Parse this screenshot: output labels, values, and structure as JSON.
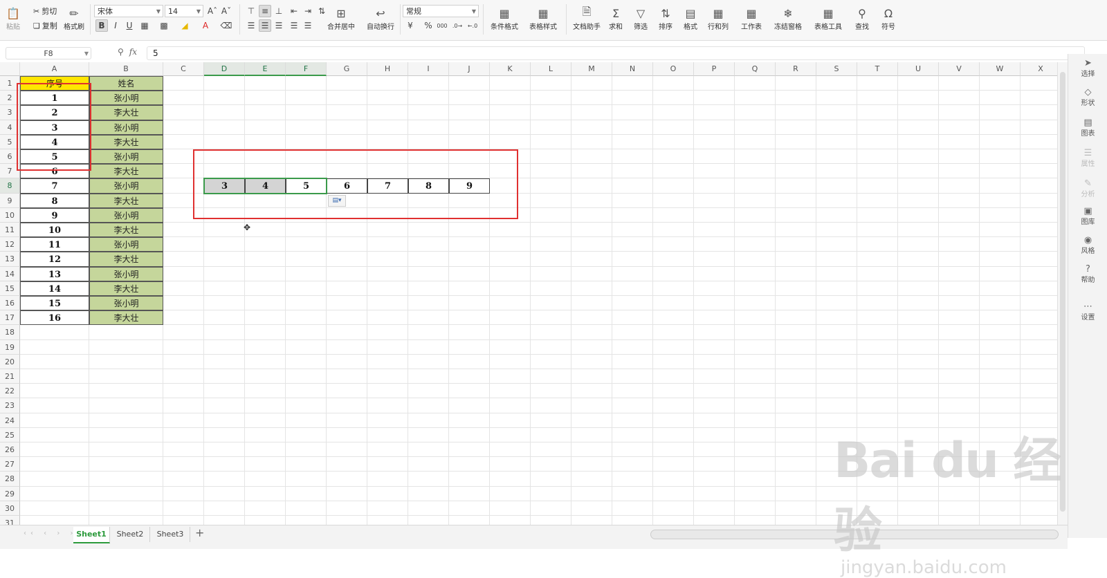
{
  "ribbon": {
    "paste": "粘贴",
    "cut": "剪切",
    "copy": "复制",
    "format_painter": "格式刷",
    "font_name": "宋体",
    "font_size": "14",
    "number_format": "常规",
    "merge_center": "合并居中",
    "wrap_text": "自动换行",
    "cond_format": "条件格式",
    "table_style": "表格样式",
    "doc_assist": "文档助手",
    "sum": "求和",
    "filter": "筛选",
    "sort": "排序",
    "format": "格式",
    "row_col": "行和列",
    "worksheet": "工作表",
    "freeze": "冻结窗格",
    "table_tools": "表格工具",
    "find": "查找",
    "symbol": "符号",
    "bold": "B",
    "italic": "I",
    "underline": "U",
    "percent": "%",
    "thousands": "000"
  },
  "formula_bar": {
    "name_box": "F8",
    "fx": "fx",
    "value": "5"
  },
  "columns": [
    "A",
    "B",
    "C",
    "D",
    "E",
    "F",
    "G",
    "H",
    "I",
    "J",
    "K",
    "L",
    "M",
    "N",
    "O",
    "P",
    "Q",
    "R",
    "S",
    "T",
    "U",
    "V",
    "W",
    "X"
  ],
  "sheet": {
    "header_a": "序号",
    "header_b": "姓名",
    "col_a": [
      "1",
      "2",
      "3",
      "4",
      "5",
      "6",
      "7",
      "8",
      "9",
      "10",
      "11",
      "12",
      "13",
      "14",
      "15",
      "16"
    ],
    "col_b": [
      "张小明",
      "李大壮",
      "张小明",
      "李大壮",
      "张小明",
      "李大壮",
      "张小明",
      "李大壮",
      "张小明",
      "李大壮",
      "张小明",
      "李大壮",
      "张小明",
      "李大壮",
      "张小明",
      "李大壮"
    ],
    "row8": [
      "3",
      "4",
      "5",
      "6",
      "7",
      "8",
      "9"
    ]
  },
  "right_panel": [
    "选择",
    "形状",
    "图表",
    "属性",
    "分析",
    "图库",
    "风格",
    "帮助",
    "设置"
  ],
  "tabs": [
    "Sheet1",
    "Sheet2",
    "Sheet3"
  ],
  "watermark": {
    "line1": "Bai du 经验",
    "line2": "jingyan.baidu.com"
  },
  "colors": {
    "header_yellow": "#ffe600",
    "name_green": "#c5d69b",
    "red_box": "#e03030",
    "active_green": "#2b9a3b"
  }
}
